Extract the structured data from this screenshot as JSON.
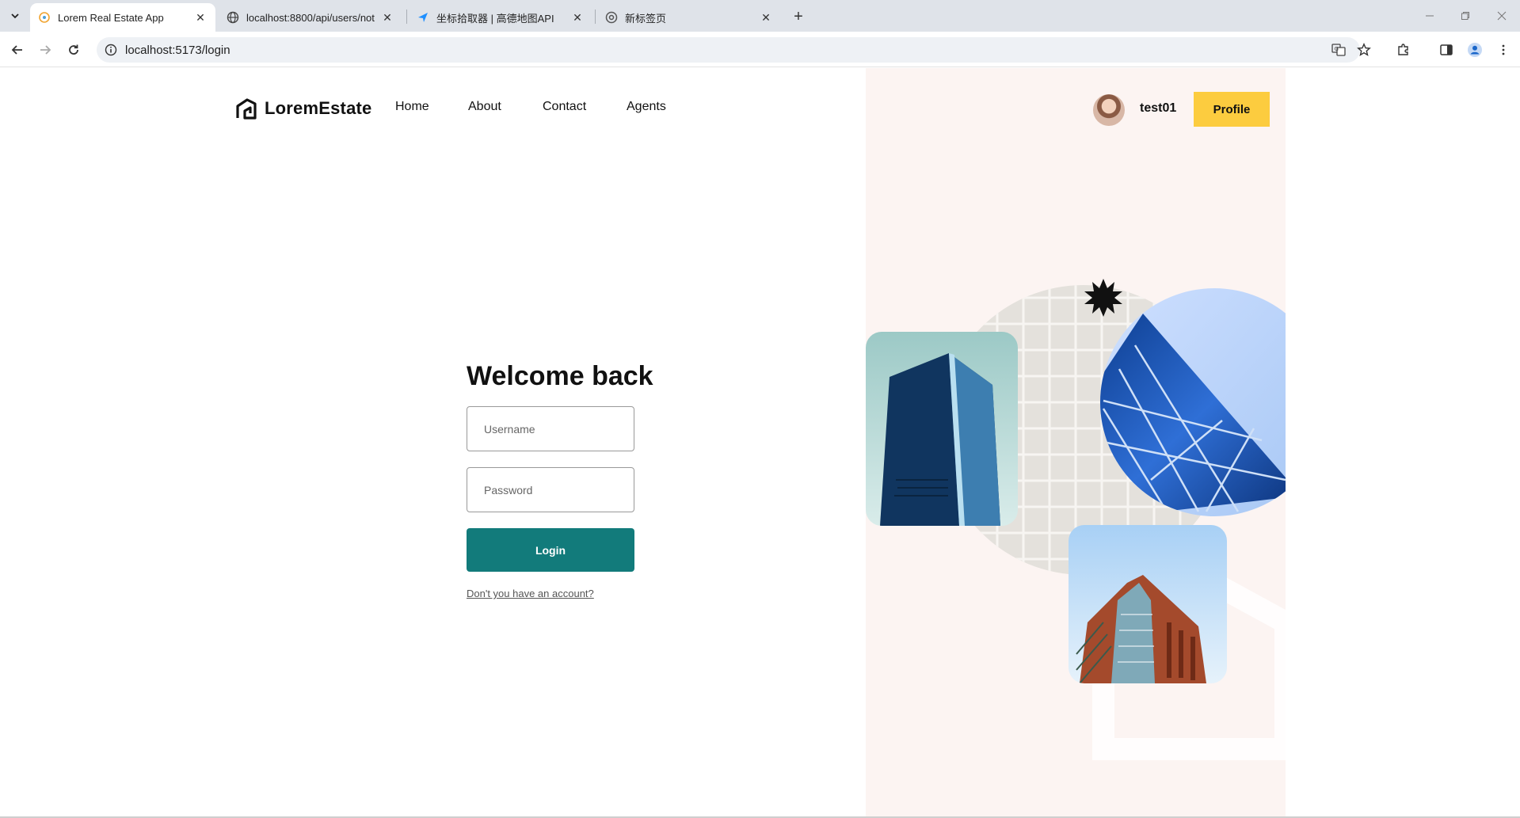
{
  "browser": {
    "tabs": [
      {
        "title": "Lorem Real Estate App",
        "active": true,
        "icon": "react-favicon-icon"
      },
      {
        "title": "localhost:8800/api/users/not",
        "active": false,
        "icon": "globe-icon"
      },
      {
        "title": "坐标拾取器 | 高德地图API",
        "active": false,
        "icon": "amap-icon"
      },
      {
        "title": "新标签页",
        "active": false,
        "icon": "chrome-icon"
      }
    ],
    "url": "localhost:5173/login"
  },
  "header": {
    "brand": "LoremEstate",
    "nav": [
      "Home",
      "About",
      "Contact",
      "Agents"
    ],
    "username": "test01",
    "profile_label": "Profile"
  },
  "login": {
    "title": "Welcome back",
    "username_placeholder": "Username",
    "password_placeholder": "Password",
    "button_label": "Login",
    "register_link": "Don't you have an account?"
  },
  "colors": {
    "accent": "#127b7b",
    "profile": "#fccc3f",
    "panel_bg": "#fcf4f2"
  }
}
